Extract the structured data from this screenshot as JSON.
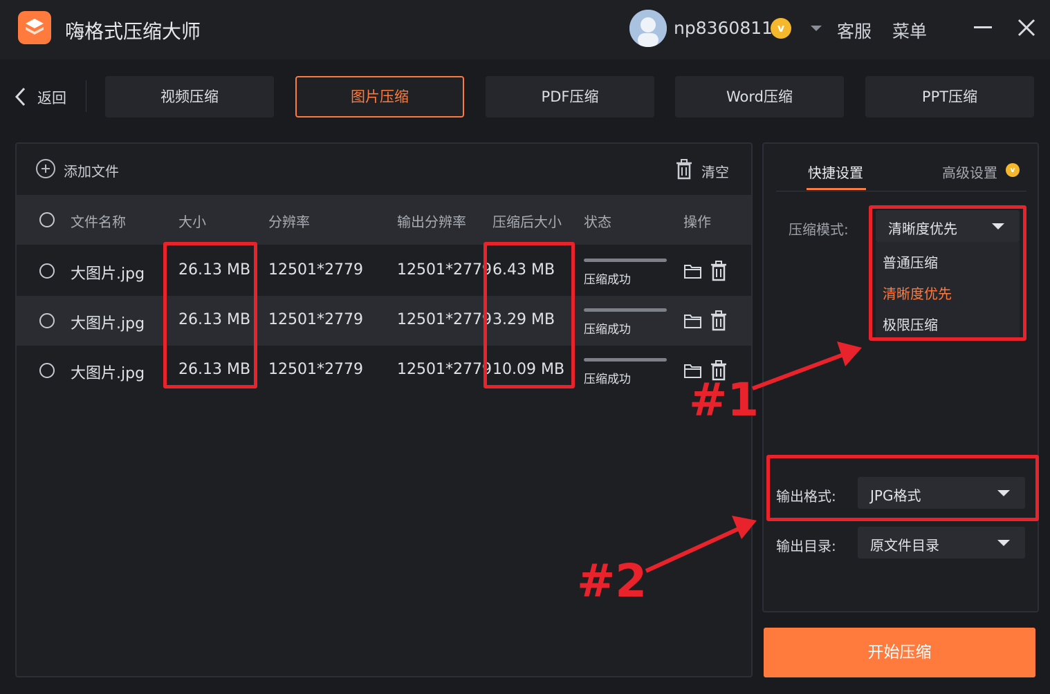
{
  "app": {
    "title": "嗨格式压缩大师",
    "username": "np8360811",
    "vip_badge": "v",
    "support_label": "客服",
    "menu_label": "菜单"
  },
  "nav": {
    "back_label": "返回",
    "tabs": [
      {
        "label": "视频压缩",
        "active": false
      },
      {
        "label": "图片压缩",
        "active": true
      },
      {
        "label": "PDF压缩",
        "active": false
      },
      {
        "label": "Word压缩",
        "active": false
      },
      {
        "label": "PPT压缩",
        "active": false
      }
    ]
  },
  "file_panel": {
    "add_file_label": "添加文件",
    "clear_label": "清空",
    "columns": {
      "name": "文件名称",
      "size": "大小",
      "resolution": "分辨率",
      "output_resolution": "输出分辨率",
      "compressed_size": "压缩后大小",
      "status": "状态",
      "actions": "操作"
    },
    "rows": [
      {
        "name": "大图片.jpg",
        "size": "26.13 MB",
        "resolution": "12501*2779",
        "output_resolution": "12501*2779",
        "compressed_size": "6.43 MB",
        "status": "压缩成功",
        "progress": 1.0
      },
      {
        "name": "大图片.jpg",
        "size": "26.13 MB",
        "resolution": "12501*2779",
        "output_resolution": "12501*2779",
        "compressed_size": "3.29 MB",
        "status": "压缩成功",
        "progress": 1.0
      },
      {
        "name": "大图片.jpg",
        "size": "26.13 MB",
        "resolution": "12501*2779",
        "output_resolution": "12501*2779",
        "compressed_size": "10.09 MB",
        "status": "压缩成功",
        "progress": 1.0
      }
    ]
  },
  "settings": {
    "tab_quick": "快捷设置",
    "tab_advanced": "高级设置",
    "compression_mode_label": "压缩模式:",
    "compression_mode_value": "清晰度优先",
    "compression_mode_options": [
      "普通压缩",
      "清晰度优先",
      "极限压缩"
    ],
    "output_format_label": "输出格式:",
    "output_format_value": "JPG格式",
    "output_dir_label": "输出目录:",
    "output_dir_value": "原文件目录"
  },
  "start_button_label": "开始压缩",
  "annotations": {
    "label_1": "#1",
    "label_2": "#2",
    "color": "#e8232b"
  },
  "colors": {
    "accent": "#ff7a3d",
    "background": "#191b1f",
    "panel": "#1d1f23",
    "vip_gold": "#f5b72b"
  }
}
